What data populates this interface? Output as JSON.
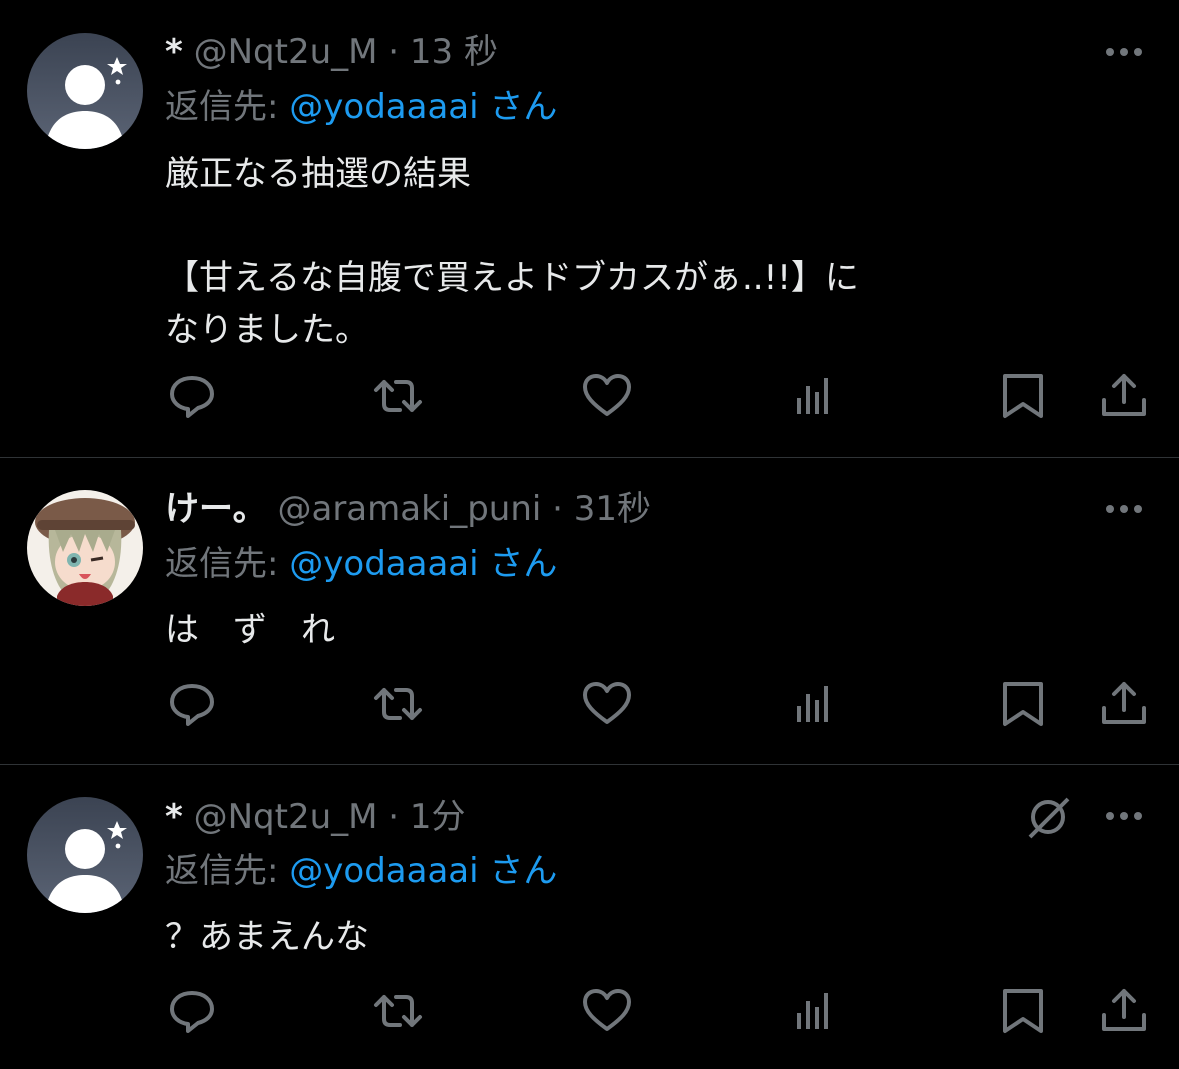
{
  "tweets": [
    {
      "name": "*",
      "handle": "@Nqt2u_M",
      "dot": "·",
      "time": "13 秒",
      "reply_prefix": "返信先: ",
      "reply_to": "@yodaaaai",
      "reply_suffix": " さん",
      "text": "厳正なる抽選の結果\n\n【甘えるな自腹で買えよドブカスがぁ..!!】に\nなりました。",
      "avatar": "default-avatar-icon"
    },
    {
      "name": "けー。",
      "handle": "@aramaki_puni",
      "dot": "·",
      "time": "31秒",
      "reply_prefix": "返信先: ",
      "reply_to": "@yodaaaai",
      "reply_suffix": " さん",
      "text": "は　ず　れ",
      "avatar": "anime-character-avatar"
    },
    {
      "name": "*",
      "handle": "@Nqt2u_M",
      "dot": "·",
      "time": "1分",
      "reply_prefix": "返信先: ",
      "reply_to": "@yodaaaai",
      "reply_suffix": " さん",
      "text": "？あまえんな",
      "avatar": "default-avatar-icon",
      "extra_icon": "grok-icon"
    }
  ],
  "icons": {
    "reply": "reply-icon",
    "retweet": "retweet-icon",
    "like": "like-icon",
    "views": "views-icon",
    "bookmark": "bookmark-icon",
    "share": "share-icon",
    "more": "more-icon"
  },
  "colors": {
    "background": "#000000",
    "text": "#e7e9ea",
    "muted": "#71767b",
    "link": "#1d9bf0",
    "divider": "#2f3336"
  }
}
